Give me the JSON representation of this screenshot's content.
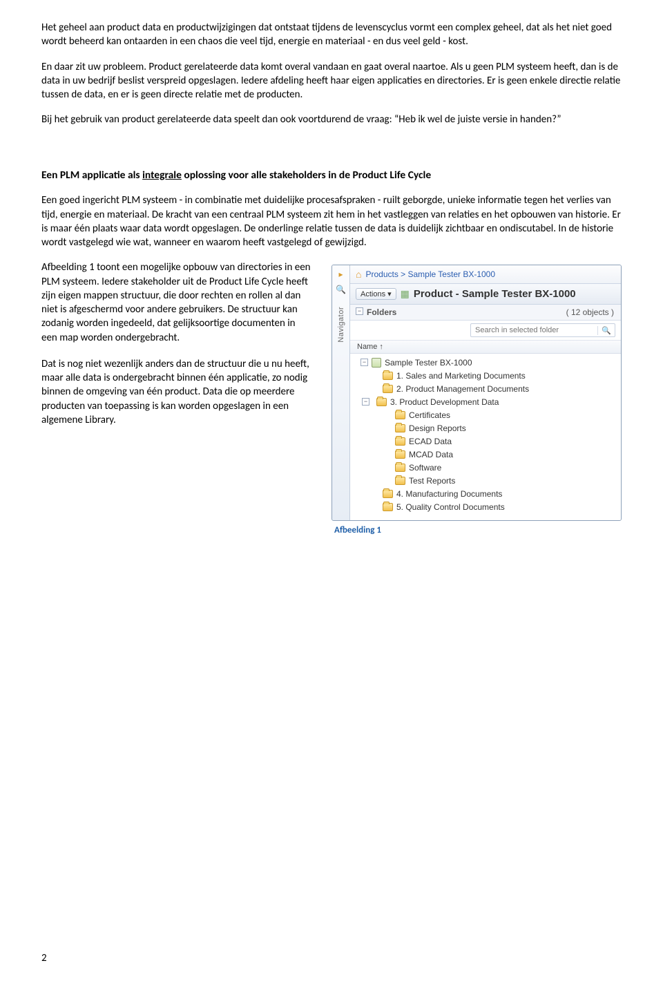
{
  "para1": "Het geheel aan product data en productwijzigingen dat ontstaat tijdens de levenscyclus vormt een complex geheel, dat als het niet goed wordt beheerd kan ontaarden in een chaos die veel tijd, energie en materiaal - en dus veel geld - kost.",
  "para2": "En daar zit uw probleem. Product gerelateerde data komt overal vandaan en gaat overal naartoe. Als u geen PLM systeem heeft, dan is de data in uw bedrijf beslist verspreid opgeslagen. Iedere afdeling heeft haar eigen applicaties en directories. Er is geen enkele directie relatie tussen de data, en er is geen directe relatie met de producten.",
  "para3": "Bij het gebruik van product gerelateerde data speelt dan ook voortdurend de vraag: “Heb ik wel de juiste versie in handen?”",
  "heading_pre": "Een PLM applicatie als ",
  "heading_underlined": "integrale",
  "heading_post": " oplossing voor alle stakeholders in de Product Life Cycle",
  "para4": "Een goed ingericht PLM systeem - in combinatie met duidelijke procesafspraken - ruilt geborgde, unieke informatie tegen het verlies van tijd, energie en materiaal.  De kracht van een centraal PLM systeem zit hem in het vastleggen van relaties en het opbouwen van historie. Er is maar één plaats waar data wordt opgeslagen. De onderlinge relatie tussen de data is duidelijk zichtbaar en ondiscutabel. In de historie wordt vastgelegd wie wat, wanneer en waarom heeft vastgelegd of gewijzigd.",
  "para5": "Afbeelding 1 toont een mogelijke opbouw van directories in een PLM systeem. Iedere stakeholder uit de Product Life Cycle heeft zijn eigen mappen structuur, die door rechten en rollen al dan niet  is afgeschermd voor andere gebruikers. De structuur kan zodanig worden ingedeeld, dat gelijksoortige documenten in een map worden ondergebracht.",
  "para6": "Dat is nog niet wezenlijk anders dan de structuur die u nu heeft, maar alle data is ondergebracht binnen één applicatie, zo nodig binnen de omgeving van één product. Data die op meerdere producten van toepassing is kan worden opgeslagen in een algemene Library.",
  "app": {
    "navigator": "Navigator",
    "breadcrumb": "Products > Sample Tester BX-1000",
    "actions": "Actions",
    "title_prefix": "Product - ",
    "title_name": "Sample Tester BX-1000",
    "folders_label": "Folders",
    "object_count": "( 12 objects )",
    "search_placeholder": "Search in selected folder",
    "col_name": "Name  ↑",
    "tree": {
      "root": "Sample Tester BX-1000",
      "n1": "1. Sales and Marketing Documents",
      "n2": "2. Product Management Documents",
      "n3": "3. Product Development Data",
      "n3a": "Certificates",
      "n3b": "Design Reports",
      "n3c": "ECAD Data",
      "n3d": "MCAD Data",
      "n3e": "Software",
      "n3f": "Test Reports",
      "n4": "4. Manufacturing Documents",
      "n5": "5. Quality Control Documents"
    }
  },
  "caption": "Afbeelding 1",
  "page": "2"
}
